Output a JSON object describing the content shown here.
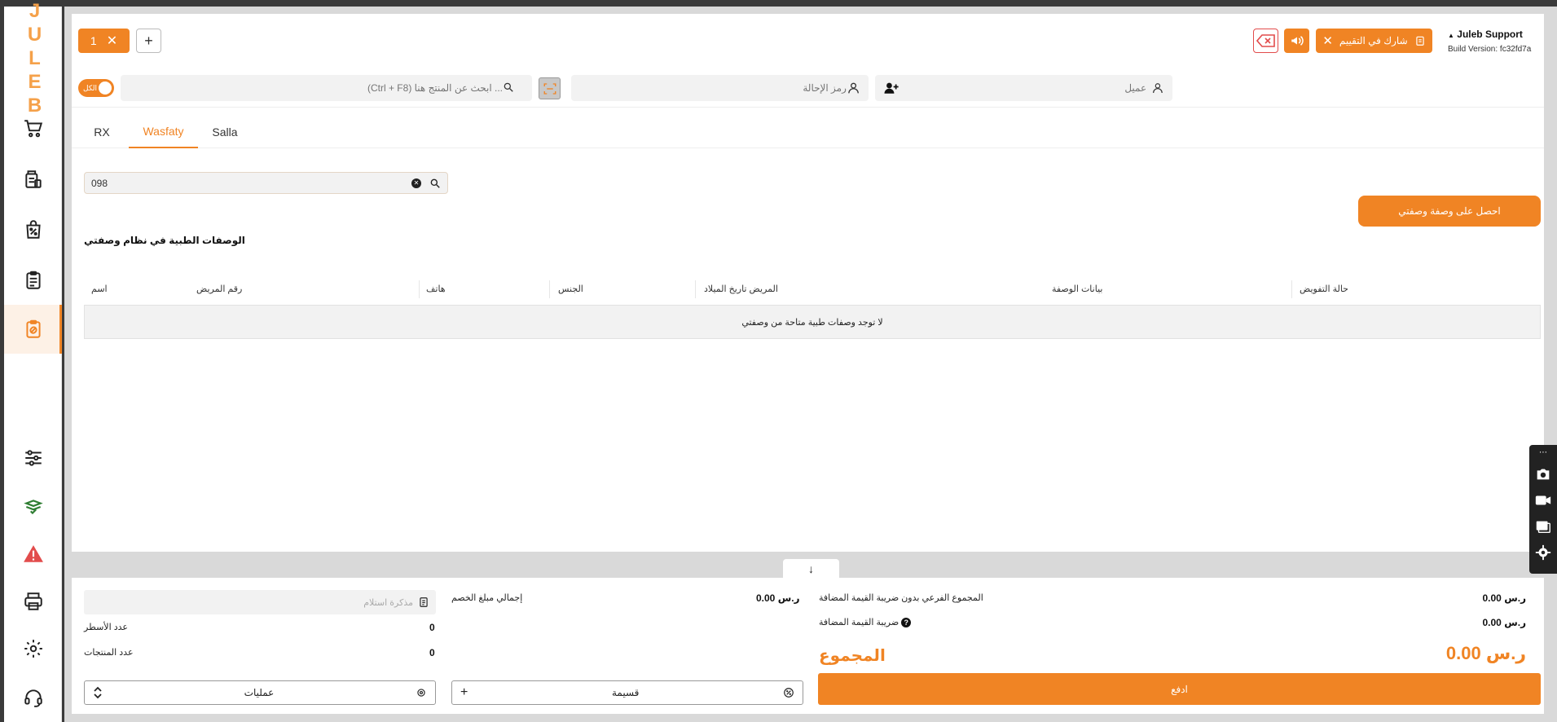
{
  "brand": {
    "logo_text": "JULEB"
  },
  "header": {
    "tab_count": "1",
    "add_tab": "+",
    "support_name": "Juleb Support",
    "build_version": "Build Version: fc32fd7a",
    "share_label": "شارك في التقييم"
  },
  "search": {
    "toggle_label": "الكل",
    "product_placeholder": "... ابحث عن المنتج هنا (Ctrl + F8)",
    "referral_placeholder": "رمز الإحالة",
    "customer_placeholder": "عميل"
  },
  "tabs": [
    {
      "label": "RX"
    },
    {
      "label": "Wasfaty"
    },
    {
      "label": "Salla"
    }
  ],
  "prescriptions": {
    "search_value": "098",
    "get_button": "احصل على وصفة وصفتي",
    "section_title": "الوصفات الطبية في نظام وصفتي",
    "columns": [
      "اسم",
      "رقم المريض",
      "هاتف",
      "الجنس",
      "المريض تاريخ الميلاد",
      "بيانات الوصفة",
      "حالة التفويض"
    ],
    "empty_message": "لا توجد وصفات طبية متاحة من وصفتي"
  },
  "summary": {
    "note_placeholder": "مذكرة استلام",
    "rows_label": "عدد الأسطر",
    "rows_value": "0",
    "products_label": "عدد المنتجات",
    "products_value": "0",
    "discount_label": "إجمالي مبلغ الخصم",
    "discount_value": "ر.س 0.00",
    "subtotal_label": "المجموع الفرعي بدون ضريبة القيمة المضافة",
    "subtotal_value": "ر.س 0.00",
    "vat_label": "ضريبة القيمة المضافة",
    "vat_value": "ر.س 0.00",
    "total_label": "المجموع",
    "total_value": "ر.س 0.00",
    "operations_label": "عمليات",
    "value_label": "قسيمة",
    "value_plus": "+",
    "pay_label": "ادفع"
  },
  "colors": {
    "accent": "#f08424",
    "danger": "#e24c4c"
  }
}
